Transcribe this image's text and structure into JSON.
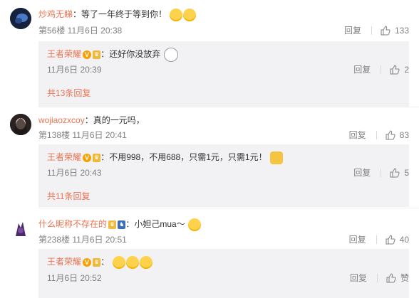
{
  "comments": [
    {
      "username": "炒鸡无睇",
      "text": "：等了一年终于等到你！",
      "floor_time": "第56楼 11月6日 20:38",
      "reply_label": "回复",
      "likes": "133",
      "reply": {
        "username": "王者荣耀",
        "badge": "V",
        "text": "：还好你没放弃",
        "time": "11月6日 20:39",
        "reply_label": "回复",
        "likes": "2"
      },
      "more_label": "共13条回复"
    },
    {
      "username": "wojiaozxcoy",
      "text": "：真的一元吗，",
      "floor_time": "第138楼 11月6日 20:41",
      "reply_label": "回复",
      "likes": "83",
      "reply": {
        "username": "王者荣耀",
        "badge": "V",
        "text": "：不用998，不用688，只需1元，只需1元！",
        "time": "11月6日 20:43",
        "reply_label": "回复",
        "likes": "5"
      },
      "more_label": "共11条回复"
    },
    {
      "username": "什么昵称不存在的",
      "text": "：小妲己mua～",
      "floor_time": "第238楼 11月6日 20:51",
      "reply_label": "回复",
      "likes": "40",
      "reply": {
        "username": "王者荣耀",
        "badge": "V",
        "text": "：",
        "time": "11月6日 20:52",
        "reply_label": "回复",
        "likes": "赞"
      }
    }
  ],
  "colors": {
    "username": "#eb7350",
    "meta": "#808080",
    "sub_bg": "#f2f2f5"
  },
  "icons": [
    "thumbs-up-icon",
    "emoji-icon",
    "vip-badge-icon"
  ]
}
